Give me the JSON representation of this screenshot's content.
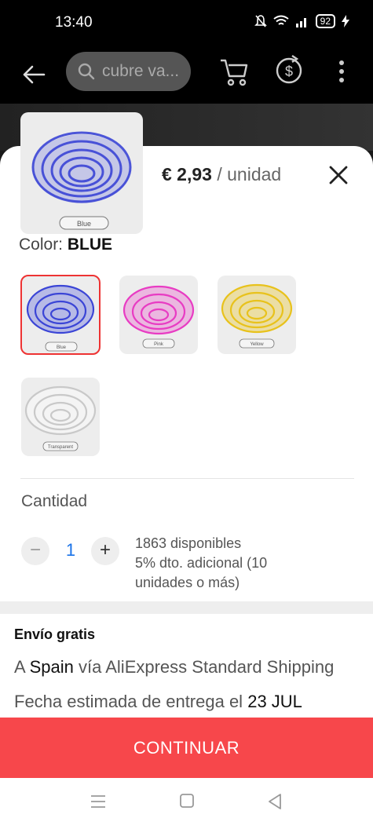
{
  "status_bar": {
    "time": "13:40",
    "battery": "92"
  },
  "header": {
    "search_placeholder": "cubre va..."
  },
  "product": {
    "price_value": "€ 2,93",
    "price_unit": "/ unidad",
    "main_thumb_caption": "Blue"
  },
  "color": {
    "label": "Color:",
    "selected": "BLUE",
    "options": [
      {
        "caption": "Blue",
        "hex": "#3b45d6"
      },
      {
        "caption": "Pink",
        "hex": "#e83cc3"
      },
      {
        "caption": "Yellow",
        "hex": "#e8c21c"
      },
      {
        "caption": "Transparent",
        "hex": "#d6d6d6"
      }
    ]
  },
  "quantity": {
    "label": "Cantidad",
    "value": "1",
    "minus": "−",
    "plus": "+",
    "available": "1863 disponibles",
    "discount": "5% dto. adicional (10 unidades o más)"
  },
  "shipping": {
    "title": "Envío gratis",
    "line1_prefix": "A",
    "line1_country": "Spain",
    "line1_suffix": "vía AliExpress Standard Shipping",
    "line2_prefix": "Fecha estimada de entrega el",
    "line2_date": "23 JUL"
  },
  "cta": {
    "label": "CONTINUAR"
  },
  "colors": {
    "accent": "#f7474b",
    "link": "#1a73e8"
  }
}
